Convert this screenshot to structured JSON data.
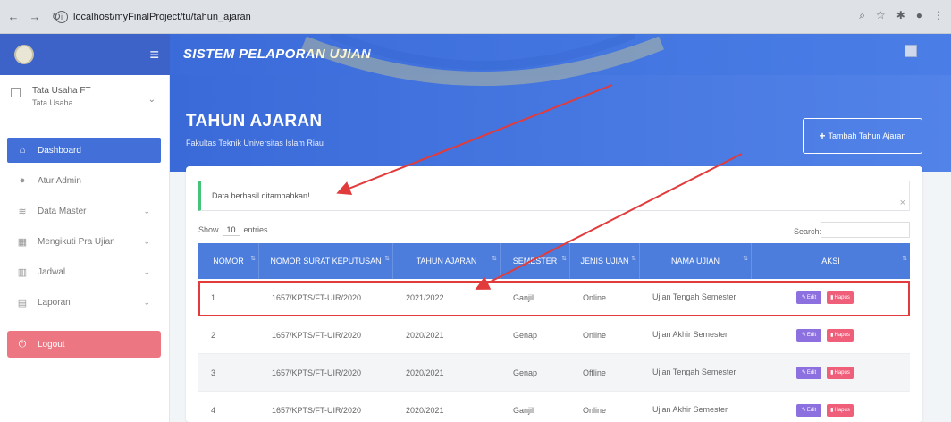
{
  "browser": {
    "url": "localhost/myFinalProject/tu/tahun_ajaran"
  },
  "app": {
    "title": "SISTEM PELAPORAN UJIAN"
  },
  "sidebar": {
    "profile_name": "Tata Usaha FT",
    "profile_role": "Tata Usaha",
    "items": [
      {
        "label": "Dashboard",
        "icon": "home-icon"
      },
      {
        "label": "Atur Admin",
        "icon": "user-icon"
      },
      {
        "label": "Data Master",
        "icon": "database-icon"
      },
      {
        "label": "Mengikuti Pra Ujian",
        "icon": "table-icon"
      },
      {
        "label": "Jadwal",
        "icon": "calendar-icon"
      },
      {
        "label": "Laporan",
        "icon": "file-icon"
      }
    ],
    "logout_label": "Logout"
  },
  "header": {
    "title": "TAHUN AJARAN",
    "subtitle": "Fakultas Teknik Universitas Islam Riau",
    "add_button": "Tambah Tahun Ajaran"
  },
  "alert": {
    "message": "Data berhasil ditambahkan!"
  },
  "table_controls": {
    "show_label": "Show",
    "entries_value": "10",
    "entries_label": "entries",
    "search_label": "Search:"
  },
  "table": {
    "columns": [
      "NOMOR",
      "NOMOR SURAT KEPUTUSAN",
      "TAHUN AJARAN",
      "SEMESTER",
      "JENIS UJIAN",
      "NAMA UJIAN",
      "AKSI"
    ],
    "rows": [
      {
        "no": "1",
        "sk": "1657/KPTS/FT-UIR/2020",
        "tahun": "2021/2022",
        "semester": "Ganjil",
        "jenis": "Online",
        "nama": "Ujian Tengah Semester"
      },
      {
        "no": "2",
        "sk": "1657/KPTS/FT-UIR/2020",
        "tahun": "2020/2021",
        "semester": "Genap",
        "jenis": "Online",
        "nama": "Ujian Akhir Semester"
      },
      {
        "no": "3",
        "sk": "1657/KPTS/FT-UIR/2020",
        "tahun": "2020/2021",
        "semester": "Genap",
        "jenis": "Offline",
        "nama": "Ujian Tengah Semester"
      },
      {
        "no": "4",
        "sk": "1657/KPTS/FT-UIR/2020",
        "tahun": "2020/2021",
        "semester": "Ganjil",
        "jenis": "Online",
        "nama": "Ujian Akhir Semester"
      }
    ],
    "edit_label": "Edit",
    "delete_label": "Hapus"
  },
  "colors": {
    "primary": "#4270d8",
    "edit": "#8d70e0",
    "delete": "#ef5f7a",
    "logout": "#ec7782",
    "highlight": "#e23b3b",
    "alert_border": "#46c37b"
  }
}
